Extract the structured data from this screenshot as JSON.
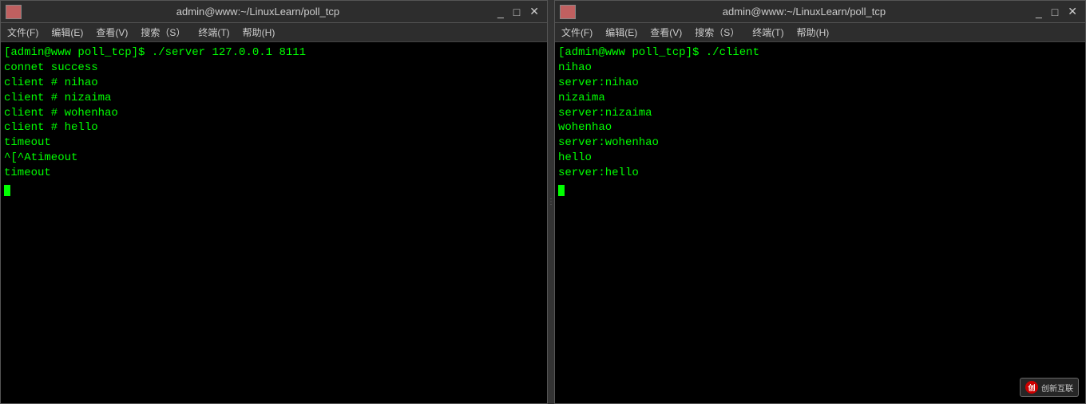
{
  "left_terminal": {
    "title": "admin@www:~/LinuxLearn/poll_tcp",
    "menu_items": [
      "文件(F)",
      "编辑(E)",
      "查看(V)",
      "搜索（S）",
      "终端(T)",
      "帮助(H)"
    ],
    "content_lines": [
      "[admin@www poll_tcp]$ ./server 127.0.0.1 8111",
      "connet success",
      "client # nihao",
      "client # nizaima",
      "client # wohenhao",
      "client # hello",
      "timeout",
      "^[^Atimeout",
      "timeout",
      ""
    ],
    "btn_minimize": "_",
    "btn_maximize": "□",
    "btn_close": "✕"
  },
  "right_terminal": {
    "title": "admin@www:~/LinuxLearn/poll_tcp",
    "menu_items": [
      "文件(F)",
      "编辑(E)",
      "查看(V)",
      "搜索（S）",
      "终端(T)",
      "帮助(H)"
    ],
    "content_lines": [
      "[admin@www poll_tcp]$ ./client",
      "nihao",
      "server:nihao",
      "nizaima",
      "server:nizaima",
      "wohenhao",
      "server:wohenhao",
      "hello",
      "server:hello",
      ""
    ],
    "btn_minimize": "_",
    "btn_maximize": "□",
    "btn_close": "✕"
  },
  "watermark": {
    "icon": "创",
    "text": "创新互联"
  }
}
